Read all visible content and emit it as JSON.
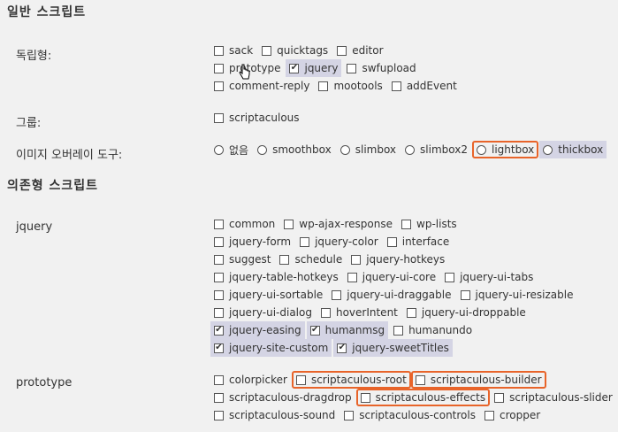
{
  "sections": {
    "general": "일반 스크립트",
    "dependent": "의존형 스크립트"
  },
  "labels": {
    "standalone": "독립형:",
    "group": "그룹:",
    "overlay": "이미지 오버레이 도구:",
    "jquery": "jquery",
    "prototype": "prototype"
  },
  "standalone": [
    [
      {
        "t": "sack",
        "c": false
      },
      {
        "t": "quicktags",
        "c": false
      },
      {
        "t": "editor",
        "c": false
      }
    ],
    [
      {
        "t": "prototype",
        "c": false
      },
      {
        "t": "jquery",
        "c": true
      },
      {
        "t": "swfupload",
        "c": false
      }
    ],
    [
      {
        "t": "comment-reply",
        "c": false
      },
      {
        "t": "mootools",
        "c": false
      },
      {
        "t": "addEvent",
        "c": false
      }
    ]
  ],
  "group": [
    [
      {
        "t": "scriptaculous",
        "c": false
      }
    ]
  ],
  "overlay": [
    [
      {
        "t": "없음",
        "c": false,
        "r": true
      },
      {
        "t": "smoothbox",
        "c": false,
        "r": true
      },
      {
        "t": "slimbox",
        "c": false,
        "r": true
      },
      {
        "t": "slimbox2",
        "c": false,
        "r": true
      },
      {
        "t": "lightbox",
        "c": false,
        "r": true,
        "h": true
      },
      {
        "t": "thickbox",
        "c": false,
        "r": true,
        "s": true
      }
    ]
  ],
  "jquery": [
    [
      {
        "t": "common",
        "c": false
      },
      {
        "t": "wp-ajax-response",
        "c": false
      },
      {
        "t": "wp-lists",
        "c": false
      }
    ],
    [
      {
        "t": "jquery-form",
        "c": false
      },
      {
        "t": "jquery-color",
        "c": false
      },
      {
        "t": "interface",
        "c": false
      }
    ],
    [
      {
        "t": "suggest",
        "c": false
      },
      {
        "t": "schedule",
        "c": false
      },
      {
        "t": "jquery-hotkeys",
        "c": false
      }
    ],
    [
      {
        "t": "jquery-table-hotkeys",
        "c": false
      },
      {
        "t": "jquery-ui-core",
        "c": false
      },
      {
        "t": "jquery-ui-tabs",
        "c": false
      }
    ],
    [
      {
        "t": "jquery-ui-sortable",
        "c": false
      },
      {
        "t": "jquery-ui-draggable",
        "c": false
      },
      {
        "t": "jquery-ui-resizable",
        "c": false
      }
    ],
    [
      {
        "t": "jquery-ui-dialog",
        "c": false
      },
      {
        "t": "hoverIntent",
        "c": false
      },
      {
        "t": "jquery-ui-droppable",
        "c": false
      }
    ],
    [
      {
        "t": "jquery-easing",
        "c": true
      },
      {
        "t": "humanmsg",
        "c": true
      },
      {
        "t": "humanundo",
        "c": false
      }
    ],
    [
      {
        "t": "jquery-site-custom",
        "c": true
      },
      {
        "t": "jquery-sweetTitles",
        "c": true
      }
    ]
  ],
  "prototype": [
    [
      {
        "t": "colorpicker",
        "c": false
      },
      {
        "t": "scriptaculous-root",
        "c": false,
        "h": true
      },
      {
        "t": "scriptaculous-builder",
        "c": false,
        "h": true
      }
    ],
    [
      {
        "t": "scriptaculous-dragdrop",
        "c": false
      },
      {
        "t": "scriptaculous-effects",
        "c": false,
        "h": true
      },
      {
        "t": "scriptaculous-slider",
        "c": false
      }
    ],
    [
      {
        "t": "scriptaculous-sound",
        "c": false
      },
      {
        "t": "scriptaculous-controls",
        "c": false
      },
      {
        "t": "cropper",
        "c": false
      }
    ]
  ],
  "colors": {
    "selected_bg": "#d4d4e4",
    "highlight_border": "#e8642a"
  }
}
